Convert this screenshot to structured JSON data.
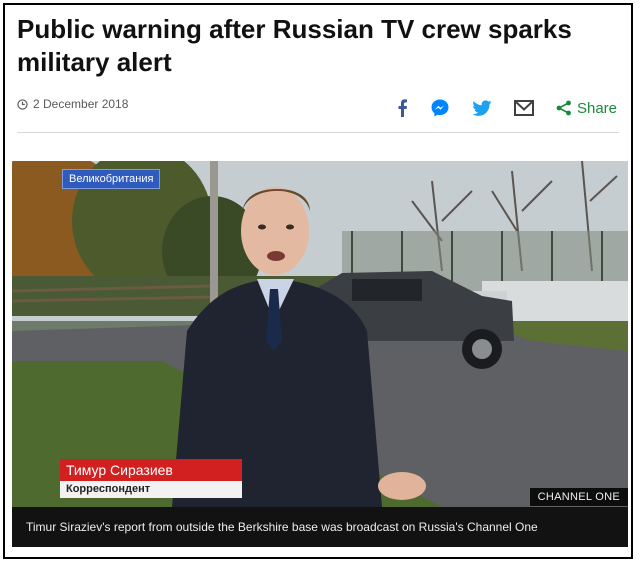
{
  "article": {
    "headline": "Public warning after Russian TV crew sparks military alert",
    "date": "2 December 2018"
  },
  "share": {
    "facebook_icon": "facebook-icon",
    "messenger_icon": "messenger-icon",
    "twitter_icon": "twitter-icon",
    "email_icon": "email-icon",
    "share_label": "Share",
    "colors": {
      "facebook": "#3b5998",
      "messenger": "#0084ff",
      "twitter": "#1da1f2",
      "email": "#404040",
      "share": "#1a8a3a"
    }
  },
  "media": {
    "location_badge": "Великобритания",
    "reporter_name": "Тимур Сиразиев",
    "reporter_role": "Корреспондент",
    "channel_label": "CHANNEL ONE",
    "caption": "Timur Siraziev's report from outside the Berkshire base was broadcast on Russia's Channel One"
  }
}
